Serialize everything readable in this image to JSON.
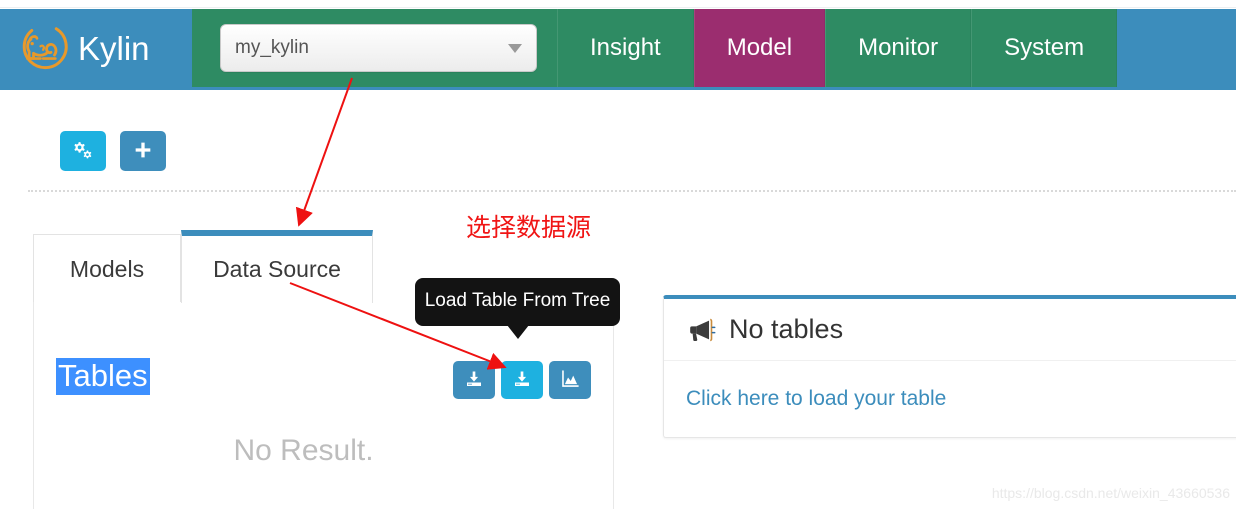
{
  "brand": {
    "name": "Kylin",
    "logo_icon": "kylin-logo-icon",
    "logo_color": "#e8992b",
    "bg_color": "#3c8dbc"
  },
  "navbar": {
    "bg_color": "#2e8b63",
    "active_color": "#9b2d6f",
    "project_select": {
      "value": "my_kylin",
      "placeholder": "my_kylin",
      "caret_icon": "chevron-down-icon"
    },
    "tabs": [
      {
        "label": "Insight",
        "active": false
      },
      {
        "label": "Model",
        "active": true
      },
      {
        "label": "Monitor",
        "active": false
      },
      {
        "label": "System",
        "active": false
      }
    ]
  },
  "toolbar": {
    "buttons": [
      {
        "icon": "cogs-icon",
        "color": "#1eb1e0",
        "label": ""
      },
      {
        "icon": "plus-icon",
        "color": "#3e8ebc",
        "label": ""
      }
    ]
  },
  "tabs": {
    "items": [
      {
        "label": "Models",
        "active": false
      },
      {
        "label": "Data Source",
        "active": true
      }
    ],
    "active_border_color": "#3c8dbc"
  },
  "left_panel": {
    "tables_label": "Tables",
    "tables_label_selected": true,
    "selection_color": "#3d90ff",
    "no_result": "No Result."
  },
  "tooltip": {
    "text": "Load Table From Tree",
    "bg_color": "#131313"
  },
  "action_buttons": [
    {
      "icon": "download-table-icon",
      "color": "#3e8ebc",
      "active": false
    },
    {
      "icon": "download-table-icon",
      "color": "#1eb1e0",
      "active": true
    },
    {
      "icon": "area-chart-icon",
      "color": "#3e8ebc",
      "active": false
    }
  ],
  "right_box": {
    "header_icon": "bullhorn-icon",
    "header_title": "No tables",
    "link_text": "Click here to load your table",
    "top_border_color": "#3c8dbc",
    "link_color": "#3c8dbc"
  },
  "annotations": {
    "chinese_note": "选择数据源",
    "note_color": "#f01515",
    "arrow_color": "#ee1111"
  },
  "watermark": {
    "text": "https://blog.csdn.net/weixin_43660536"
  }
}
